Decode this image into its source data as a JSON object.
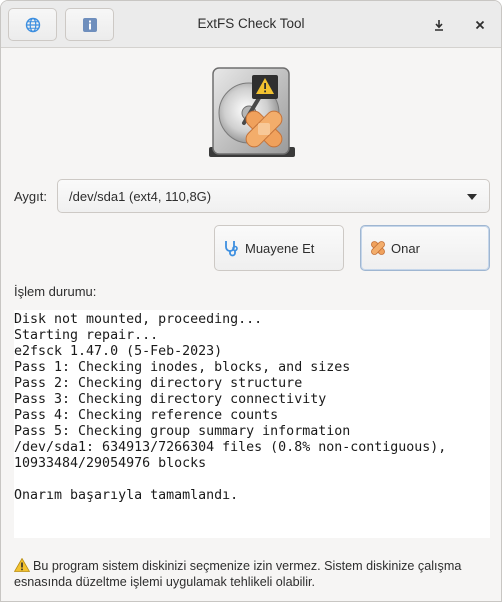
{
  "window": {
    "title": "ExtFS Check Tool"
  },
  "header": {
    "lang_icon": "globe-icon",
    "info_icon": "info-icon",
    "download_icon": "download-icon",
    "close_icon": "close-icon"
  },
  "device": {
    "label": "Aygıt:",
    "selected": "/dev/sda1 (ext4, 110,8G)"
  },
  "actions": {
    "inspect_label": "Muayene Et",
    "repair_label": "Onar"
  },
  "status": {
    "label": "İşlem durumu:",
    "log": [
      "Disk not mounted, proceeding...",
      "Starting repair...",
      "e2fsck 1.47.0 (5-Feb-2023)",
      "Pass 1: Checking inodes, blocks, and sizes",
      "Pass 2: Checking directory structure",
      "Pass 3: Checking directory connectivity",
      "Pass 4: Checking reference counts",
      "Pass 5: Checking group summary information",
      "/dev/sda1: 634913/7266304 files (0.8% non-contiguous),",
      "10933484/29054976 blocks",
      "",
      "Onarım başarıyla tamamlandı."
    ]
  },
  "warning": {
    "text": "Bu program sistem diskinizi seçmenize izin vermez. Sistem diskinize çalışma esnasında düzeltme işlemi uygulamak tehlikeli olabilir."
  },
  "colors": {
    "accent": "#f0a15c",
    "info": "#5b88c9"
  }
}
